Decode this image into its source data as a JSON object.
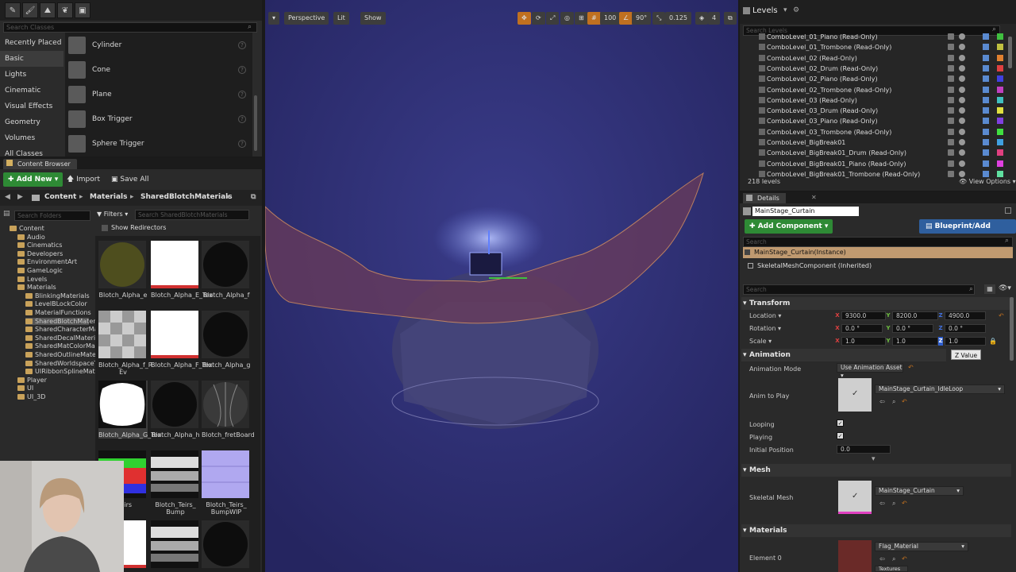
{
  "modes": {
    "search_placeholder": "Search Classes",
    "categories": [
      "Recently Placed",
      "Basic",
      "Lights",
      "Cinematic",
      "Visual Effects",
      "Geometry",
      "Volumes",
      "All Classes"
    ],
    "active_category": "Basic",
    "items": [
      "Cylinder",
      "Cone",
      "Plane",
      "Box Trigger",
      "Sphere Trigger"
    ]
  },
  "content_browser": {
    "tab": "Content Browser",
    "add_new": "Add New",
    "import": "Import",
    "save_all": "Save All",
    "crumbs": [
      "Content",
      "Materials",
      "SharedBlotchMaterials"
    ],
    "folder_search_placeholder": "Search Folders",
    "filters": "Filters",
    "asset_search_placeholder": "Search SharedBlotchMaterials",
    "show_redirectors": "Show Redirectors",
    "tree": [
      {
        "label": "Content",
        "indent": 0
      },
      {
        "label": "Audio",
        "indent": 1
      },
      {
        "label": "Cinematics",
        "indent": 1
      },
      {
        "label": "Developers",
        "indent": 1
      },
      {
        "label": "EnvironmentArt",
        "indent": 1
      },
      {
        "label": "GameLogic",
        "indent": 1
      },
      {
        "label": "Levels",
        "indent": 1
      },
      {
        "label": "Materials",
        "indent": 1
      },
      {
        "label": "BlinkingMaterials",
        "indent": 2
      },
      {
        "label": "LevelBLockColor",
        "indent": 2
      },
      {
        "label": "MaterialFunctions",
        "indent": 2
      },
      {
        "label": "SharedBlotchMateri",
        "indent": 2
      },
      {
        "label": "SharedCharacterMat",
        "indent": 2
      },
      {
        "label": "SharedDecalMateria",
        "indent": 2
      },
      {
        "label": "SharedMatColorMat",
        "indent": 2
      },
      {
        "label": "SharedOutlineMater",
        "indent": 2
      },
      {
        "label": "SharedWorldspaceT",
        "indent": 2
      },
      {
        "label": "UIRibbonSplineMate",
        "indent": 2
      },
      {
        "label": "Player",
        "indent": 1
      },
      {
        "label": "UI",
        "indent": 1
      },
      {
        "label": "UI_3D",
        "indent": 1
      }
    ],
    "assets": [
      {
        "label": "Blotch_Alpha_e",
        "thumb": "olive"
      },
      {
        "label": "Blotch_Alpha_E_Tex",
        "thumb": "white"
      },
      {
        "label": "Blotch_Alpha_f",
        "thumb": "black"
      },
      {
        "label": "Blotch_Alpha_f_R Ev",
        "thumb": "checker"
      },
      {
        "label": "Blotch_Alpha_F_Tex",
        "thumb": "white"
      },
      {
        "label": "Blotch_Alpha_g",
        "thumb": "black"
      },
      {
        "label": "Blotch_Alpha_G_Tex",
        "thumb": "blob"
      },
      {
        "label": "Blotch_Alpha_h",
        "thumb": "black"
      },
      {
        "label": "Blotch_fretBoard",
        "thumb": "fret"
      },
      {
        "label": "_Teirs",
        "thumb": "rgb"
      },
      {
        "label": "Blotch_Teirs_ Bump",
        "thumb": "bump"
      },
      {
        "label": "Blotch_Teirs_ BumpWIP",
        "thumb": "purple"
      }
    ]
  },
  "viewport": {
    "perspective": "Perspective",
    "lit": "Lit",
    "show": "Show",
    "grid_snap": "100",
    "rot_snap": "90°",
    "scale_snap": "0.125",
    "cam_speed": "4"
  },
  "levels": {
    "title": "Levels",
    "search_placeholder": "Search Levels",
    "rows": [
      {
        "name": "ComboLevel_01_Piano (Read-Only)",
        "color": "#40c040"
      },
      {
        "name": "ComboLevel_01_Trombone (Read-Only)",
        "color": "#c0c040"
      },
      {
        "name": "ComboLevel_02 (Read-Only)",
        "color": "#e08030"
      },
      {
        "name": "ComboLevel_02_Drum (Read-Only)",
        "color": "#e04040"
      },
      {
        "name": "ComboLevel_02_Piano (Read-Only)",
        "color": "#4040e0"
      },
      {
        "name": "ComboLevel_02_Trombone (Read-Only)",
        "color": "#c040c0"
      },
      {
        "name": "ComboLevel_03 (Read-Only)",
        "color": "#40c0c0"
      },
      {
        "name": "ComboLevel_03_Drum (Read-Only)",
        "color": "#e0e040"
      },
      {
        "name": "ComboLevel_03_Piano (Read-Only)",
        "color": "#8040e0"
      },
      {
        "name": "ComboLevel_03_Trombone (Read-Only)",
        "color": "#40e040"
      },
      {
        "name": "ComboLevel_BigBreak01",
        "color": "#40a0e0"
      },
      {
        "name": "ComboLevel_BigBreak01_Drum (Read-Only)",
        "color": "#e04080"
      },
      {
        "name": "ComboLevel_BigBreak01_Piano (Read-Only)",
        "color": "#e040e0"
      },
      {
        "name": "ComboLevel_BigBreak01_Trombone (Read-Only)",
        "color": "#60e0a0"
      }
    ],
    "count": "218 levels",
    "view_options": "View Options"
  },
  "details": {
    "tab": "Details",
    "actor_name": "MainStage_Curtain",
    "add_component": "Add Component",
    "blueprint": "Blueprint/Add Script",
    "search_placeholder": "Search",
    "instance": "MainStage_Curtain(Instance)",
    "component": "SkeletalMeshComponent (Inherited)",
    "search2_placeholder": "Search",
    "transform": {
      "title": "Transform",
      "location_label": "Location",
      "location": [
        "9300.0",
        "8200.0",
        "4900.0"
      ],
      "rotation_label": "Rotation",
      "rotation": [
        "0.0 °",
        "0.0 °",
        "0.0 °"
      ],
      "scale_label": "Scale",
      "scale": [
        "1.0",
        "1.0",
        "1.0"
      ],
      "tooltip": "Z Value"
    },
    "animation": {
      "title": "Animation",
      "mode_label": "Animation Mode",
      "mode": "Use Animation Asset",
      "anim_label": "Anim to Play",
      "anim": "MainStage_Curtain_IdleLoop",
      "looping_label": "Looping",
      "playing_label": "Playing",
      "initpos_label": "Initial Position",
      "initpos": "0.0"
    },
    "mesh": {
      "title": "Mesh",
      "label": "Skeletal Mesh",
      "value": "MainStage_Curtain"
    },
    "materials": {
      "title": "Materials",
      "label": "Element 0",
      "value": "Flag_Material",
      "sub": "Textures"
    }
  }
}
